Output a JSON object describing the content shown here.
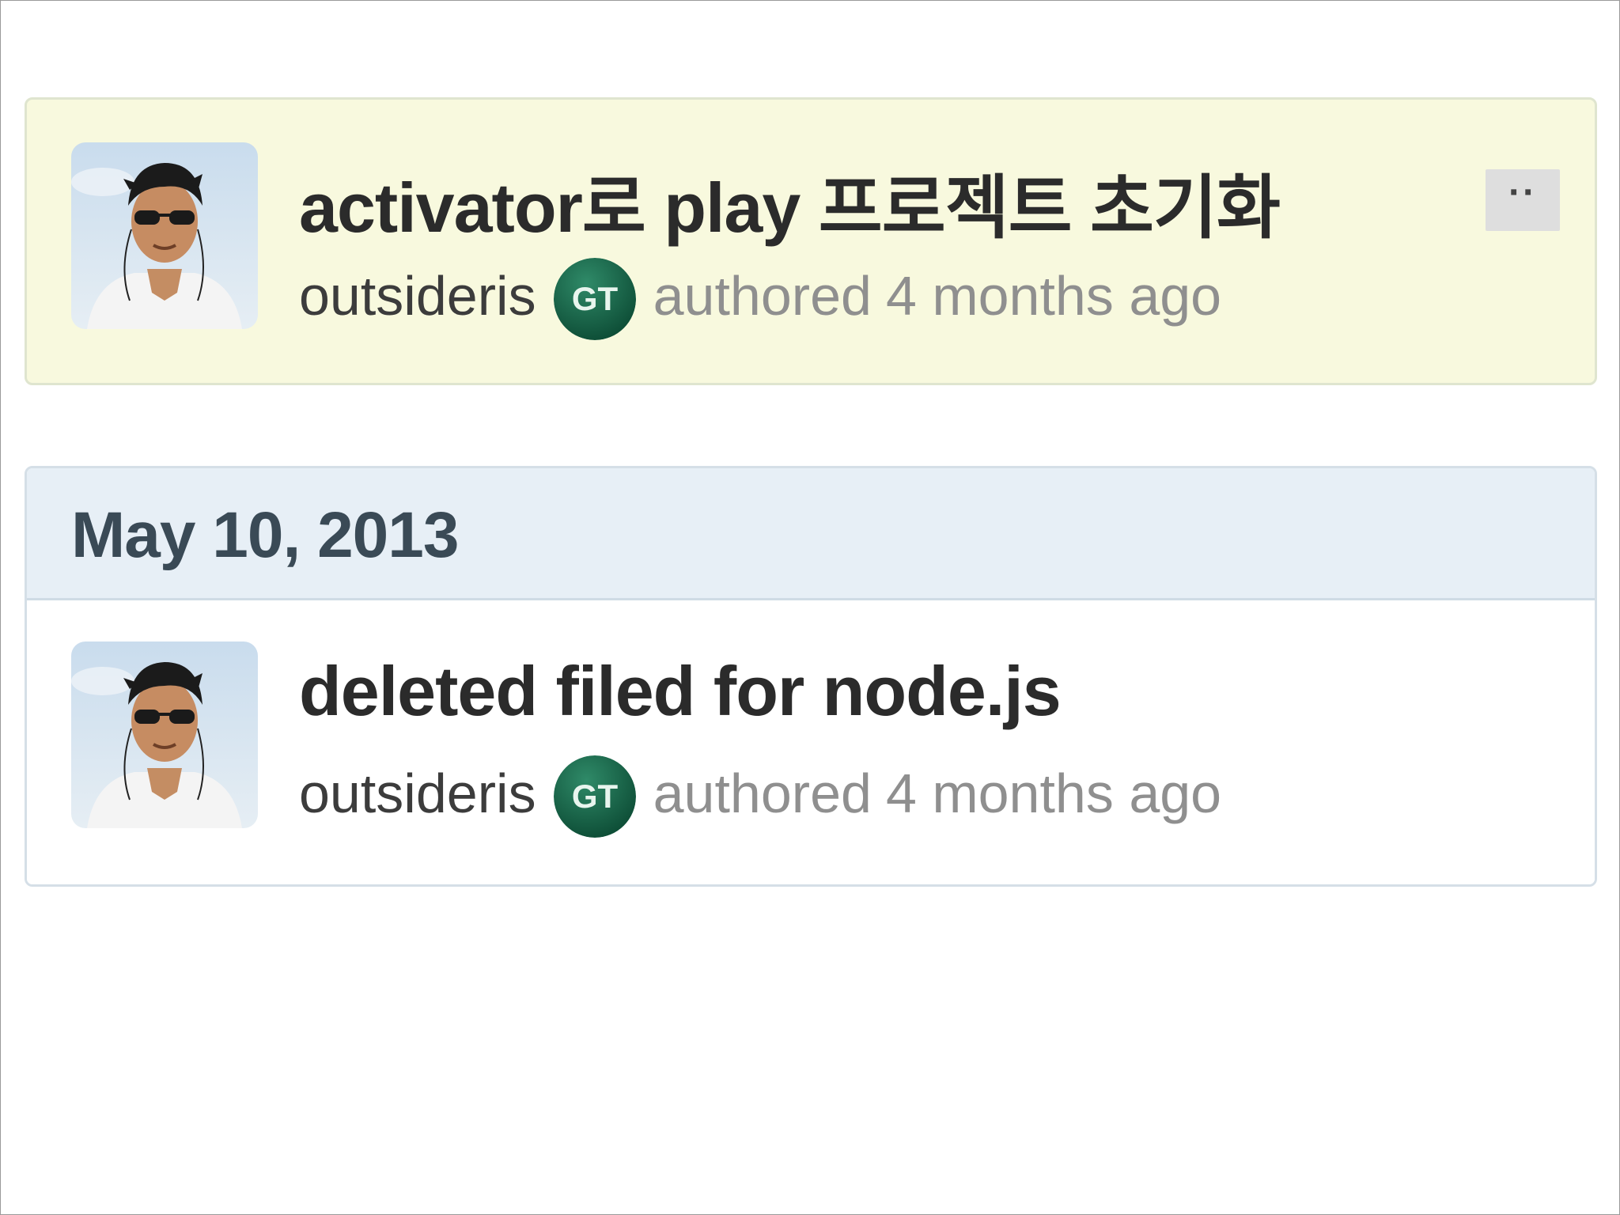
{
  "commits_top": {
    "title": "activator로 play 프로젝트 초기화",
    "author": "outsideris",
    "committer_badge": "GT",
    "action": "authored",
    "time": "4 months ago",
    "more_button_label": "··",
    "avatar_icon": "user-photo-icon",
    "highlight_color": "#f8f9de"
  },
  "group": {
    "date": "May 10, 2013",
    "commits": [
      {
        "title": "deleted filed for node.js",
        "author": "outsideris",
        "committer_badge": "GT",
        "action": "authored",
        "time": "4 months ago",
        "avatar_icon": "user-photo-icon"
      }
    ]
  },
  "colors": {
    "badge_green": "#0f5a40",
    "group_header_bg": "#e7eff6",
    "title_text": "#2b2b2b",
    "meta_text": "#8f8f8f"
  }
}
